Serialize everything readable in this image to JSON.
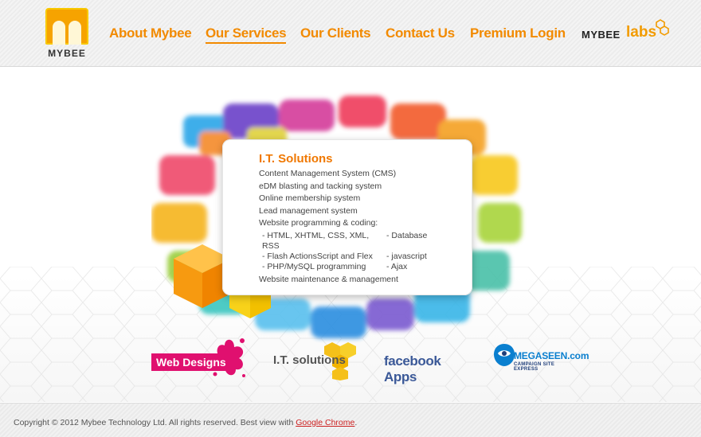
{
  "brand": {
    "logo_text": "MYBEE",
    "labs_word1": "MYBEE",
    "labs_word2": "labs"
  },
  "nav": {
    "items": [
      {
        "label": "About Mybee"
      },
      {
        "label": "Our Services"
      },
      {
        "label": "Our Clients"
      },
      {
        "label": "Contact Us"
      },
      {
        "label": "Premium Login"
      }
    ],
    "active_index": 1
  },
  "card": {
    "title": "I.T. Solutions",
    "items": [
      "Content Management System (CMS)",
      "eDM blasting and tacking system",
      "Online membership system",
      "Lead management system",
      "Website programming & coding:"
    ],
    "tech_rows": [
      {
        "left": "- HTML, XHTML, CSS, XML, RSS",
        "right": "- Database"
      },
      {
        "left": "- Flash ActionsScript and Flex",
        "right": "- javascript"
      },
      {
        "left": "- PHP/MySQL programming",
        "right": "- Ajax"
      }
    ],
    "last_item": "Website maintenance & management"
  },
  "links": {
    "web_designs": "Web Designs",
    "it_solutions": "I.T. solutions",
    "facebook_apps": "facebook Apps",
    "megaseen": "MEGASEEN.com",
    "megaseen_tagline": "CAMPAIGN SITE EXPRESS"
  },
  "footer": {
    "copyright": "Copyright © 2012 Mybee Technology Ltd. All rights reserved. Best view with",
    "link": "Google Chrome",
    "tail": "."
  },
  "colors": {
    "accent": "#f28a00",
    "pink": "#e0106f",
    "facebook": "#3b5998",
    "megaseen": "#0a7fcf"
  }
}
